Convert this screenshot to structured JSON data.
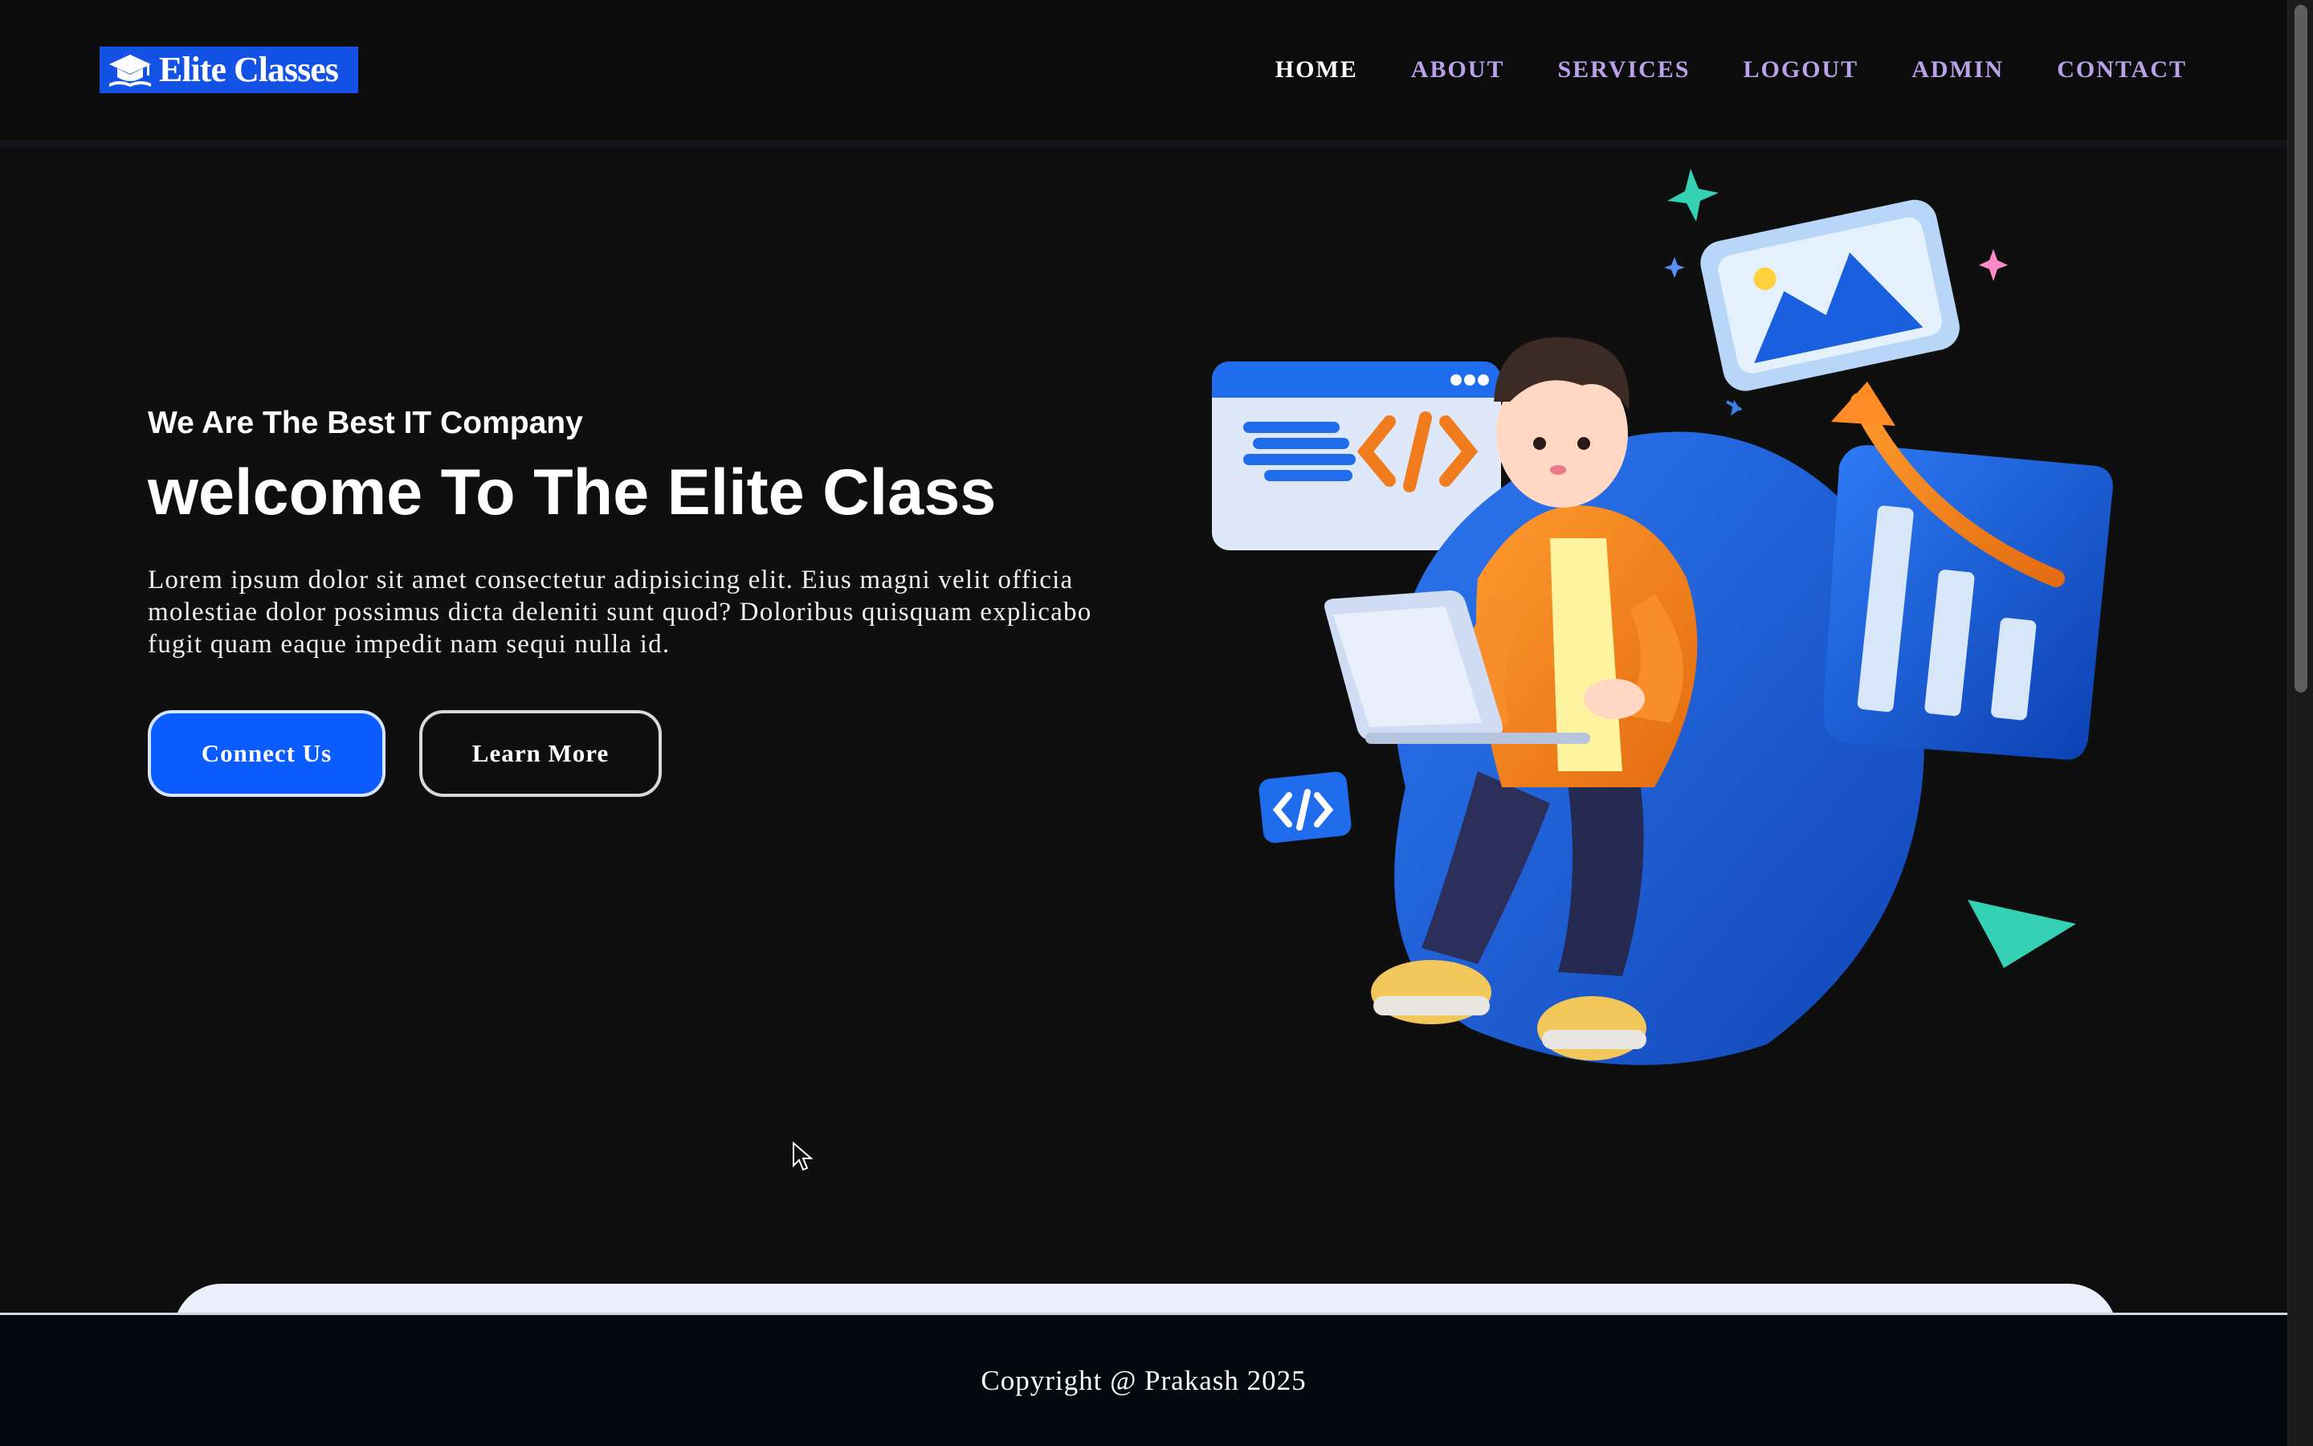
{
  "brand": {
    "logo_text": "Elite Classes"
  },
  "nav": {
    "items": [
      {
        "label": "HOME",
        "active": true
      },
      {
        "label": "ABOUT"
      },
      {
        "label": "SERVICES"
      },
      {
        "label": "LOGOUT"
      },
      {
        "label": "ADMIN"
      },
      {
        "label": "CONTACT"
      }
    ]
  },
  "hero": {
    "subtitle": "We Are The Best IT Company",
    "title": "welcome To The Elite Class",
    "description": "Lorem ipsum dolor sit amet consectetur adipisicing elit. Eius magni velit officia molestiae dolor possimus dicta deleniti sunt quod? Doloribus quisquam explicabo fugit quam eaque impedit nam sequi nulla id.",
    "primary_button": "Connect Us",
    "secondary_button": "Learn More"
  },
  "footer": {
    "copyright": "Copyright @ Prakash 2025"
  },
  "colors": {
    "accent": "#0a5cff",
    "nav_link": "#b9a2e8",
    "background": "#0f0f10",
    "footer_bg": "#040910"
  },
  "icons": {
    "logo": "graduation-cap-icon",
    "cursor": "mouse-pointer-icon"
  }
}
